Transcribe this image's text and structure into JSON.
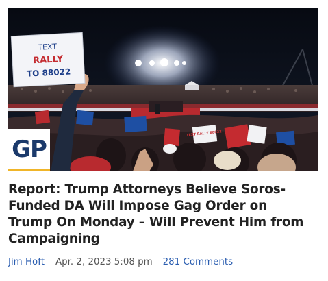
{
  "article": {
    "image_alt": "Trump rally crowd at night",
    "sign_text": [
      "TEXT",
      "RALLY",
      "TO 88022"
    ],
    "small_sign_text": "TEXT RALLY 88022",
    "logo_text": "GP",
    "headline": "Report: Trump Attorneys Believe Soros-Funded DA Will Impose Gag Order on Trump On Monday – Will Prevent Him from Campaigning",
    "author": "Jim Hoft",
    "date": "Apr. 2, 2023 5:08 pm",
    "comments": "281 Comments"
  },
  "colors": {
    "link": "#2a5db0",
    "headline": "#222222",
    "meta_text": "#555555",
    "logo_blue": "#1b3a6b",
    "logo_accent": "#f0b529"
  }
}
